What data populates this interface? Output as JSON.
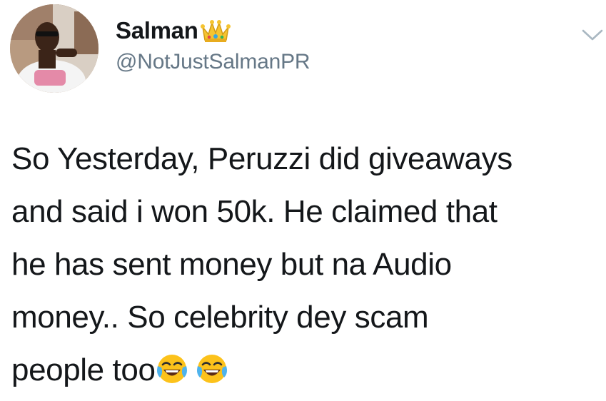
{
  "user": {
    "display_name": "Salman",
    "handle": "@NotJustSalmanPR",
    "name_emoji": "crown-icon"
  },
  "menu": {
    "icon": "chevron-down-icon"
  },
  "tweet": {
    "lines": [
      "So Yesterday, Peruzzi did giveaways",
      "and said i won 50k. He claimed that",
      "he has sent money but na Audio",
      "money.. So celebrity dey scam",
      "people too"
    ],
    "trailing_emojis": [
      "face-with-tears-of-joy-icon",
      "face-with-tears-of-joy-icon"
    ]
  },
  "colors": {
    "text": "#14171a",
    "handle": "#657786",
    "chevron": "#aab8c2"
  }
}
